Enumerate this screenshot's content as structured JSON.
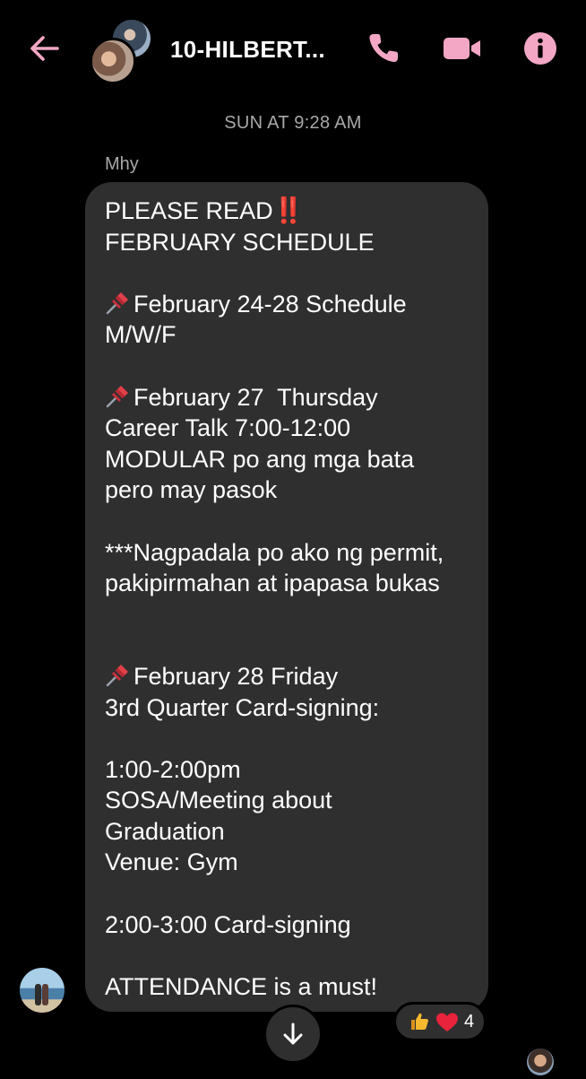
{
  "header": {
    "title": "10-HILBERT...",
    "back_icon": "arrow-left-icon",
    "call_icon": "phone-icon",
    "video_icon": "video-camera-icon",
    "info_icon": "info-icon",
    "accent_color": "#f3a7c5"
  },
  "conversation": {
    "timestamp": "SUN AT 9:28 AM",
    "sender_name": "Mhy",
    "message_lines": [
      {
        "text": "PLEASE READ",
        "suffix": "‼️"
      },
      {
        "text": "FEBRUARY SCHEDULE"
      },
      {
        "text": ""
      },
      {
        "text": "February 24-28 Schedule",
        "pin": true
      },
      {
        "text": "M/W/F"
      },
      {
        "text": ""
      },
      {
        "text": "February 27  Thursday",
        "pin": true
      },
      {
        "text": "Career Talk 7:00-12:00"
      },
      {
        "text": "MODULAR po ang mga bata"
      },
      {
        "text": "pero may pasok"
      },
      {
        "text": ""
      },
      {
        "text": "***Nagpadala po ako ng permit,"
      },
      {
        "text": "pakipirmahan at ipapasa bukas"
      },
      {
        "text": ""
      },
      {
        "text": ""
      },
      {
        "text": "February 28 Friday",
        "pin": true
      },
      {
        "text": "3rd Quarter Card-signing:"
      },
      {
        "text": ""
      },
      {
        "text": "1:00-2:00pm"
      },
      {
        "text": "SOSA/Meeting about"
      },
      {
        "text": "Graduation"
      },
      {
        "text": "Venue: Gym"
      },
      {
        "text": ""
      },
      {
        "text": "2:00-3:00 Card-signing"
      },
      {
        "text": ""
      },
      {
        "text": "ATTENDANCE is a must!"
      }
    ],
    "reactions": {
      "emojis": [
        "thumbs-up-icon",
        "red-heart-icon"
      ],
      "count": "4"
    },
    "scroll_down_icon": "arrow-down-icon"
  },
  "colors": {
    "background": "#000000",
    "bubble": "#2f2f2f",
    "muted_text": "#a8a8a8"
  }
}
